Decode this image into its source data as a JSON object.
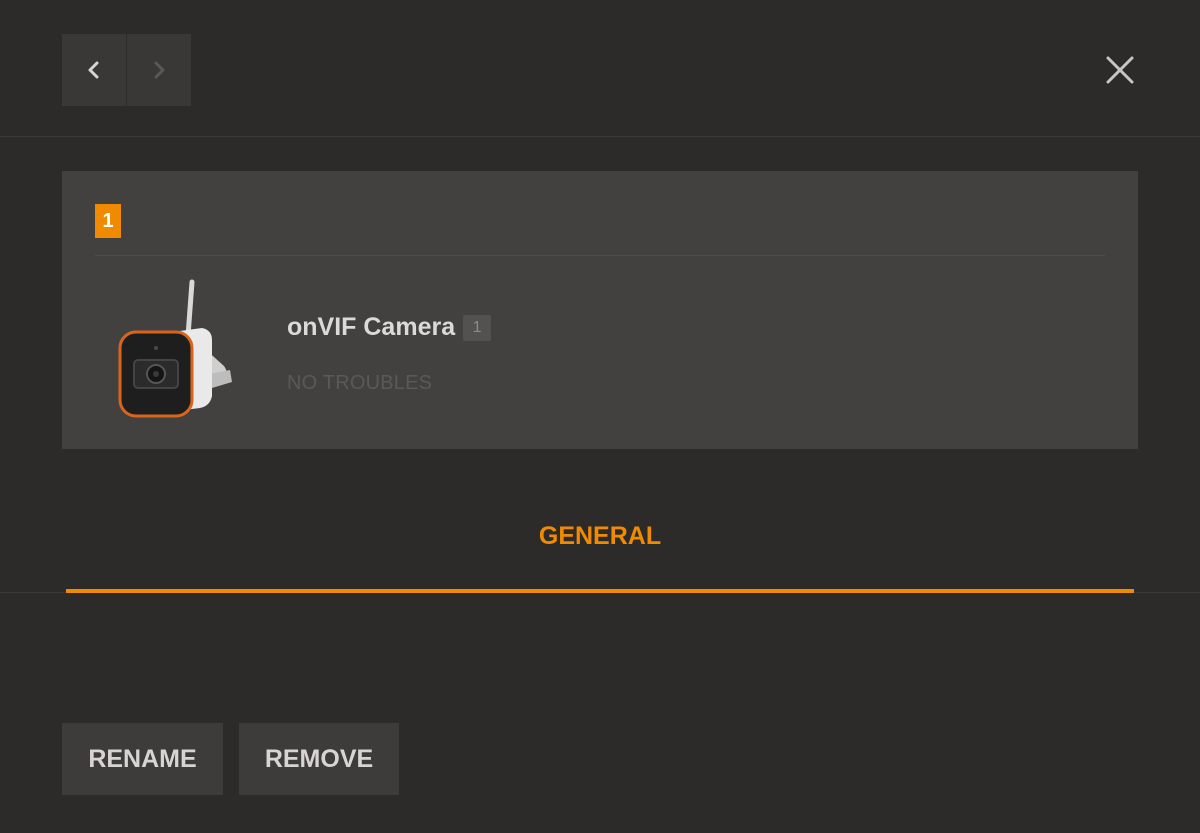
{
  "header": {
    "back_icon": "chevron-left-icon",
    "forward_icon": "chevron-right-icon",
    "close_icon": "close-icon"
  },
  "device": {
    "index": "1",
    "name": "onVIF Camera",
    "count": "1",
    "status": "NO TROUBLES",
    "image_icon": "outdoor-camera-icon"
  },
  "tabs": [
    {
      "label": "GENERAL",
      "active": true
    }
  ],
  "actions": {
    "rename_label": "RENAME",
    "remove_label": "REMOVE"
  },
  "colors": {
    "accent": "#f08a00",
    "background": "#2d2b2a",
    "card": "#434140",
    "button": "#3e3c3a"
  }
}
